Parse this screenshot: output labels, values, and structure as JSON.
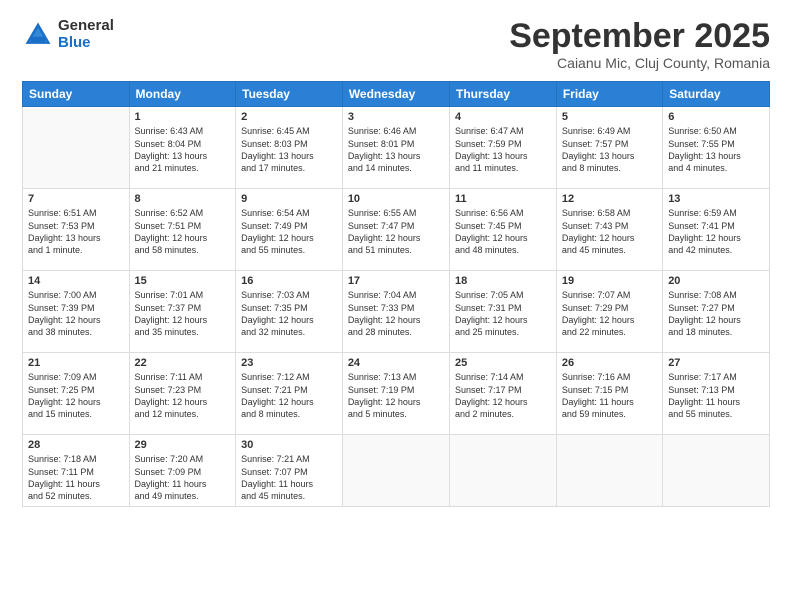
{
  "logo": {
    "general": "General",
    "blue": "Blue"
  },
  "title": "September 2025",
  "location": "Caianu Mic, Cluj County, Romania",
  "days_header": [
    "Sunday",
    "Monday",
    "Tuesday",
    "Wednesday",
    "Thursday",
    "Friday",
    "Saturday"
  ],
  "weeks": [
    [
      {
        "day": "",
        "info": ""
      },
      {
        "day": "1",
        "info": "Sunrise: 6:43 AM\nSunset: 8:04 PM\nDaylight: 13 hours\nand 21 minutes."
      },
      {
        "day": "2",
        "info": "Sunrise: 6:45 AM\nSunset: 8:03 PM\nDaylight: 13 hours\nand 17 minutes."
      },
      {
        "day": "3",
        "info": "Sunrise: 6:46 AM\nSunset: 8:01 PM\nDaylight: 13 hours\nand 14 minutes."
      },
      {
        "day": "4",
        "info": "Sunrise: 6:47 AM\nSunset: 7:59 PM\nDaylight: 13 hours\nand 11 minutes."
      },
      {
        "day": "5",
        "info": "Sunrise: 6:49 AM\nSunset: 7:57 PM\nDaylight: 13 hours\nand 8 minutes."
      },
      {
        "day": "6",
        "info": "Sunrise: 6:50 AM\nSunset: 7:55 PM\nDaylight: 13 hours\nand 4 minutes."
      }
    ],
    [
      {
        "day": "7",
        "info": "Sunrise: 6:51 AM\nSunset: 7:53 PM\nDaylight: 13 hours\nand 1 minute."
      },
      {
        "day": "8",
        "info": "Sunrise: 6:52 AM\nSunset: 7:51 PM\nDaylight: 12 hours\nand 58 minutes."
      },
      {
        "day": "9",
        "info": "Sunrise: 6:54 AM\nSunset: 7:49 PM\nDaylight: 12 hours\nand 55 minutes."
      },
      {
        "day": "10",
        "info": "Sunrise: 6:55 AM\nSunset: 7:47 PM\nDaylight: 12 hours\nand 51 minutes."
      },
      {
        "day": "11",
        "info": "Sunrise: 6:56 AM\nSunset: 7:45 PM\nDaylight: 12 hours\nand 48 minutes."
      },
      {
        "day": "12",
        "info": "Sunrise: 6:58 AM\nSunset: 7:43 PM\nDaylight: 12 hours\nand 45 minutes."
      },
      {
        "day": "13",
        "info": "Sunrise: 6:59 AM\nSunset: 7:41 PM\nDaylight: 12 hours\nand 42 minutes."
      }
    ],
    [
      {
        "day": "14",
        "info": "Sunrise: 7:00 AM\nSunset: 7:39 PM\nDaylight: 12 hours\nand 38 minutes."
      },
      {
        "day": "15",
        "info": "Sunrise: 7:01 AM\nSunset: 7:37 PM\nDaylight: 12 hours\nand 35 minutes."
      },
      {
        "day": "16",
        "info": "Sunrise: 7:03 AM\nSunset: 7:35 PM\nDaylight: 12 hours\nand 32 minutes."
      },
      {
        "day": "17",
        "info": "Sunrise: 7:04 AM\nSunset: 7:33 PM\nDaylight: 12 hours\nand 28 minutes."
      },
      {
        "day": "18",
        "info": "Sunrise: 7:05 AM\nSunset: 7:31 PM\nDaylight: 12 hours\nand 25 minutes."
      },
      {
        "day": "19",
        "info": "Sunrise: 7:07 AM\nSunset: 7:29 PM\nDaylight: 12 hours\nand 22 minutes."
      },
      {
        "day": "20",
        "info": "Sunrise: 7:08 AM\nSunset: 7:27 PM\nDaylight: 12 hours\nand 18 minutes."
      }
    ],
    [
      {
        "day": "21",
        "info": "Sunrise: 7:09 AM\nSunset: 7:25 PM\nDaylight: 12 hours\nand 15 minutes."
      },
      {
        "day": "22",
        "info": "Sunrise: 7:11 AM\nSunset: 7:23 PM\nDaylight: 12 hours\nand 12 minutes."
      },
      {
        "day": "23",
        "info": "Sunrise: 7:12 AM\nSunset: 7:21 PM\nDaylight: 12 hours\nand 8 minutes."
      },
      {
        "day": "24",
        "info": "Sunrise: 7:13 AM\nSunset: 7:19 PM\nDaylight: 12 hours\nand 5 minutes."
      },
      {
        "day": "25",
        "info": "Sunrise: 7:14 AM\nSunset: 7:17 PM\nDaylight: 12 hours\nand 2 minutes."
      },
      {
        "day": "26",
        "info": "Sunrise: 7:16 AM\nSunset: 7:15 PM\nDaylight: 11 hours\nand 59 minutes."
      },
      {
        "day": "27",
        "info": "Sunrise: 7:17 AM\nSunset: 7:13 PM\nDaylight: 11 hours\nand 55 minutes."
      }
    ],
    [
      {
        "day": "28",
        "info": "Sunrise: 7:18 AM\nSunset: 7:11 PM\nDaylight: 11 hours\nand 52 minutes."
      },
      {
        "day": "29",
        "info": "Sunrise: 7:20 AM\nSunset: 7:09 PM\nDaylight: 11 hours\nand 49 minutes."
      },
      {
        "day": "30",
        "info": "Sunrise: 7:21 AM\nSunset: 7:07 PM\nDaylight: 11 hours\nand 45 minutes."
      },
      {
        "day": "",
        "info": ""
      },
      {
        "day": "",
        "info": ""
      },
      {
        "day": "",
        "info": ""
      },
      {
        "day": "",
        "info": ""
      }
    ]
  ]
}
